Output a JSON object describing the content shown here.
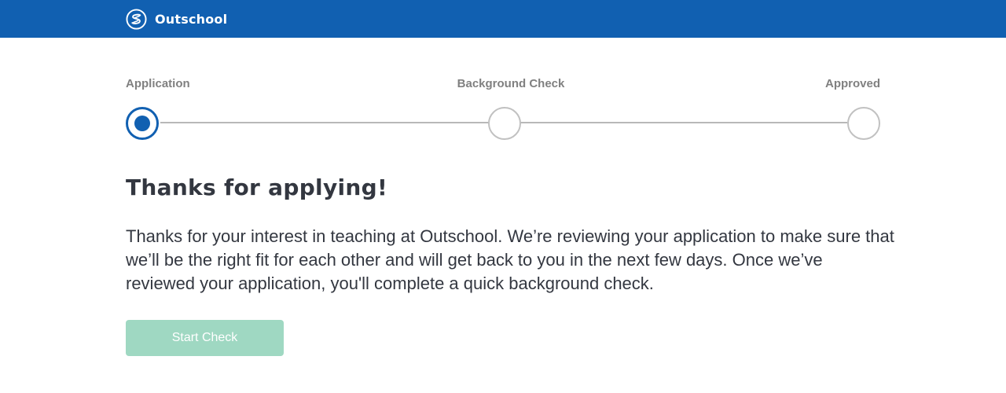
{
  "header": {
    "brand_name": "Outschool",
    "logo_icon": "outschool-logo-icon",
    "background_color": "#1160b1"
  },
  "stepper": {
    "steps": [
      {
        "label": "Application",
        "state": "current"
      },
      {
        "label": "Background Check",
        "state": "pending"
      },
      {
        "label": "Approved",
        "state": "pending"
      }
    ],
    "active_color": "#1160b1",
    "inactive_color": "#c1c1c1"
  },
  "content": {
    "title": "Thanks for applying!",
    "body": "Thanks for your interest in teaching at Outschool. We’re reviewing your application to make sure that we’ll be the right fit for each other and will get back to you in the next few days. Once we’ve reviewed your application, you'll complete a quick background check.",
    "button_label": "Start Check",
    "button_color": "#9fd8c2"
  }
}
